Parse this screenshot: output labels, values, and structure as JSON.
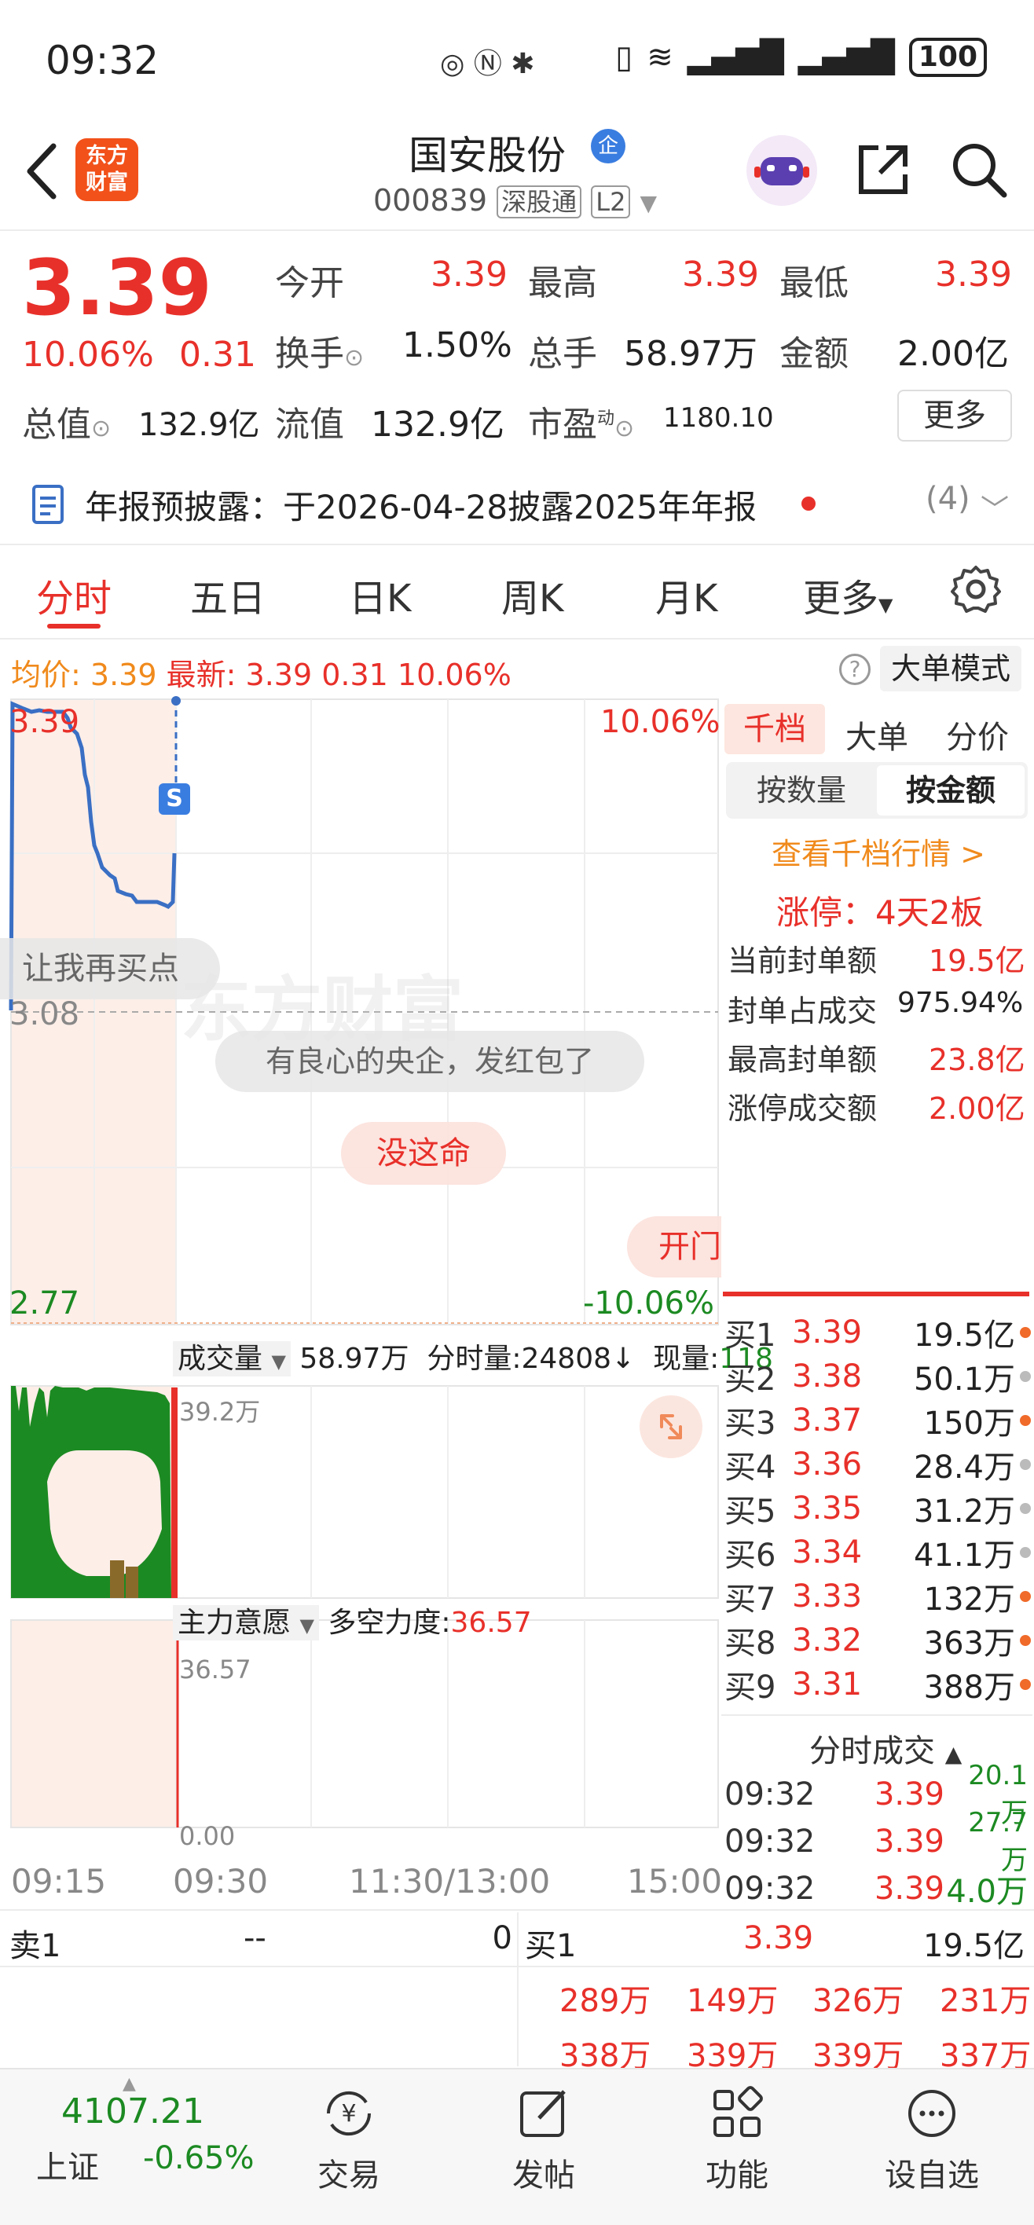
{
  "status_bar": {
    "time": "09:32",
    "battery": "100"
  },
  "header": {
    "stock_name": "国安股份",
    "badge": "企",
    "code": "000839",
    "tag1": "深股通",
    "tag2": "L2",
    "logo_line1": "东方",
    "logo_line2": "财富"
  },
  "quote": {
    "price": "3.39",
    "change_pct": "10.06%",
    "change_amt": "0.31",
    "open_label": "今开",
    "open": "3.39",
    "high_label": "最高",
    "high": "3.39",
    "low_label": "最低",
    "low": "3.39",
    "turnover_label": "换手",
    "turnover": "1.50%",
    "volume_label": "总手",
    "volume": "58.97万",
    "amount_label": "金额",
    "amount": "2.00亿",
    "mcap_label": "总值",
    "mcap": "132.9亿",
    "float_label": "流值",
    "float": "132.9亿",
    "pe_label": "市盈",
    "pe_sup": "动",
    "pe": "1180.10",
    "more": "更多"
  },
  "announcement": {
    "text": "年报预披露：于2026-04-28披露2025年年报",
    "count": "(4)"
  },
  "tabs": [
    "分时",
    "五日",
    "日K",
    "周K",
    "月K",
    "更多"
  ],
  "avg_line": {
    "avg_label": "均价:",
    "avg": "3.39",
    "latest_label": "最新:",
    "latest": "3.39",
    "chg": "0.31",
    "pct": "10.06%",
    "bigorder": "大单模式"
  },
  "chart": {
    "high": "3.39",
    "mid": "3.08",
    "low": "2.77",
    "high_pct": "10.06%",
    "low_pct": "-10.06%",
    "s_marker": "S",
    "watermark": "东方财富",
    "bubble_buypoint": "让我再买点",
    "bubble_conscience": "有良心的央企，发红包了",
    "bubble_nolucky": "没这命",
    "bubble_open": "开门红"
  },
  "volume": {
    "label": "成交量",
    "total": "58.97万",
    "tick_label": "分时量:",
    "tick": "24808",
    "tick_arrow": "↓",
    "now_label": "现量:",
    "now": "118",
    "max": "39.2万"
  },
  "moneyflow": {
    "label": "主力意愿",
    "power_label": "多空力度:",
    "power": "36.57",
    "max": "36.57",
    "min": "0.00"
  },
  "times": [
    "09:15",
    "09:30",
    "11:30/13:00",
    "15:00"
  ],
  "right_panel": {
    "tabs": [
      "千档",
      "大单",
      "分价"
    ],
    "seg_qty": "按数量",
    "seg_amt": "按金额",
    "view_qd": "查看千档行情 >",
    "limitup": "涨停：4天2板",
    "seal": [
      {
        "label": "当前封单额",
        "value": "19.5亿"
      },
      {
        "label": "封单占成交",
        "value": "975.94%"
      },
      {
        "label": "最高封单额",
        "value": "23.8亿"
      },
      {
        "label": "涨停成交额",
        "value": "2.00亿"
      }
    ],
    "orderbook": [
      {
        "label": "买1",
        "price": "3.39",
        "vol": "19.5亿",
        "dot": "#f06a2a"
      },
      {
        "label": "买2",
        "price": "3.38",
        "vol": "50.1万",
        "dot": "#bbbbbb"
      },
      {
        "label": "买3",
        "price": "3.37",
        "vol": "150万",
        "dot": "#f06a2a"
      },
      {
        "label": "买4",
        "price": "3.36",
        "vol": "28.4万",
        "dot": "#bbbbbb"
      },
      {
        "label": "买5",
        "price": "3.35",
        "vol": "31.2万",
        "dot": "#bbbbbb"
      },
      {
        "label": "买6",
        "price": "3.34",
        "vol": "41.1万",
        "dot": "#bbbbbb"
      },
      {
        "label": "买7",
        "price": "3.33",
        "vol": "132万",
        "dot": "#f06a2a"
      },
      {
        "label": "买8",
        "price": "3.32",
        "vol": "363万",
        "dot": "#f06a2a"
      },
      {
        "label": "买9",
        "price": "3.31",
        "vol": "388万",
        "dot": "#f06a2a"
      }
    ],
    "trades_header": "分时成交",
    "trades": [
      {
        "time": "09:32",
        "price": "3.39",
        "vol": "20.1万"
      },
      {
        "time": "09:32",
        "price": "3.39",
        "vol": "27.7万"
      },
      {
        "time": "09:32",
        "price": "3.39",
        "vol": "4.0万"
      }
    ]
  },
  "level1": {
    "sell1_label": "卖1",
    "sell1_price": "--",
    "sell1_vol": "0",
    "buy1_label": "买1",
    "buy1_price": "3.39",
    "buy1_vol": "19.5亿",
    "big_orders_row1": [
      "289万",
      "149万",
      "326万",
      "231万"
    ],
    "big_orders_row2": [
      "338万",
      "339万",
      "339万",
      "337万"
    ]
  },
  "bottom_nav": {
    "index_value": "4107.21",
    "index_name": "上证",
    "index_change": "-0.65%",
    "items": [
      "交易",
      "发帖",
      "功能",
      "设自选"
    ]
  },
  "colors": {
    "up": "#e8302a",
    "down": "#1c8a22",
    "accent": "#f08a1c",
    "line": "#3a6fc4"
  }
}
